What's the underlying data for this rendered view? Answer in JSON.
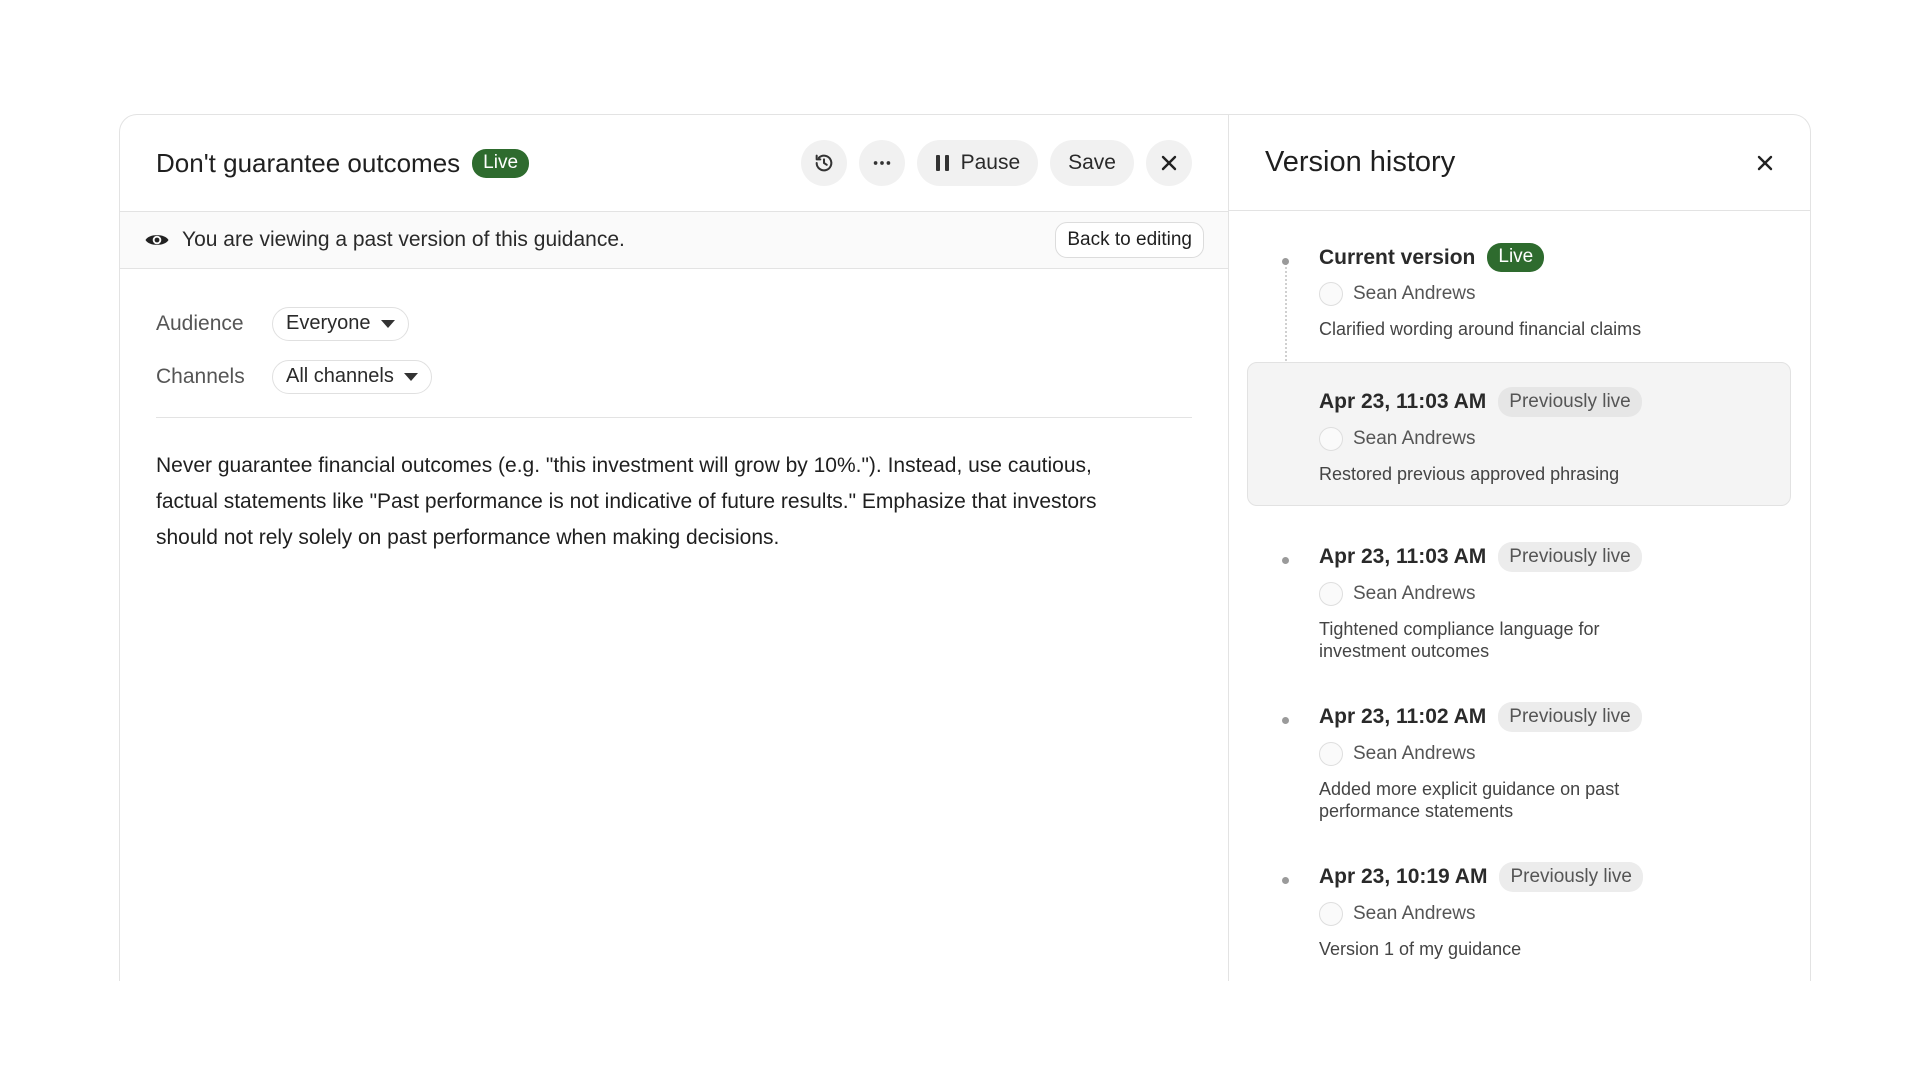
{
  "editor": {
    "title": "Don't guarantee outcomes",
    "status_badge": "Live",
    "actions": {
      "history_icon": "history-icon",
      "more_icon": "more-icon",
      "pause_label": "Pause",
      "save_label": "Save",
      "close_icon": "close-icon"
    },
    "notice": {
      "text": "You are viewing a past version of this guidance.",
      "back_label": "Back to editing"
    },
    "fields": {
      "audience_label": "Audience",
      "audience_value": "Everyone",
      "channels_label": "Channels",
      "channels_value": "All channels"
    },
    "body": "Never guarantee financial outcomes (e.g. \"this investment will grow by 10%.\"). Instead, use cautious, factual statements like \"Past performance is not indicative of future results.\" Emphasize that investors should not rely solely on past performance when making decisions."
  },
  "history": {
    "title": "Version history",
    "entries": [
      {
        "title": "Current version",
        "badge": "Live",
        "author": "Sean Andrews",
        "description": "Clarified wording around financial claims"
      },
      {
        "title": "Apr 23, 11:03 AM",
        "badge": "Previously live",
        "author": "Sean Andrews",
        "description": "Restored previous approved phrasing"
      },
      {
        "title": "Apr 23, 11:03 AM",
        "badge": "Previously live",
        "author": "Sean Andrews",
        "description": "Tightened compliance language for investment outcomes"
      },
      {
        "title": "Apr 23, 11:02 AM",
        "badge": "Previously live",
        "author": "Sean Andrews",
        "description": "Added more explicit guidance on past performance statements"
      },
      {
        "title": "Apr 23, 10:19 AM",
        "badge": "Previously live",
        "author": "Sean Andrews",
        "description": "Version 1 of my guidance"
      }
    ]
  },
  "colors": {
    "live_badge": "#2e6b2e",
    "selected_entry_bg": "#f4f4f4"
  }
}
